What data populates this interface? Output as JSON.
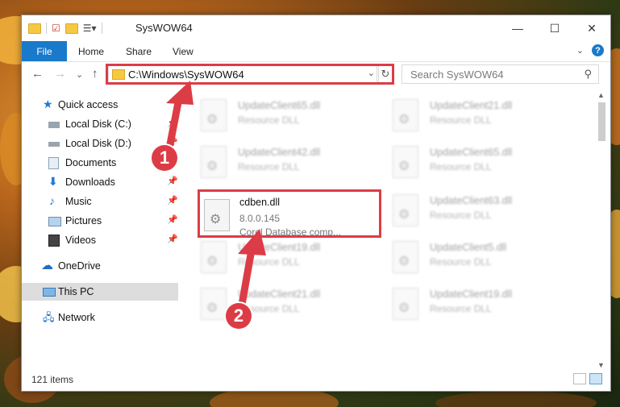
{
  "window": {
    "title": "SysWOW64",
    "minimize": "—",
    "maximize": "☐",
    "close": "✕"
  },
  "ribbon": {
    "file_tab": "File",
    "tabs": [
      "Home",
      "Share",
      "View"
    ],
    "expand": "⌄",
    "help": "?"
  },
  "navigation": {
    "back": "←",
    "forward": "→",
    "recent": "⌄",
    "up": "↑",
    "address": "C:\\Windows\\SysWOW64",
    "address_dropdown": "⌄",
    "refresh": "↻",
    "search_placeholder": "Search SysWOW64",
    "search_icon": "⚲"
  },
  "sidebar": {
    "items": [
      {
        "label": "Quick access",
        "icon": "star-icon",
        "pinned": false
      },
      {
        "label": "Local Disk (C:)",
        "icon": "drive-icon",
        "pinned": true
      },
      {
        "label": "Local Disk (D:)",
        "icon": "drive-icon",
        "pinned": true
      },
      {
        "label": "Documents",
        "icon": "documents-icon",
        "pinned": true
      },
      {
        "label": "Downloads",
        "icon": "download-icon",
        "pinned": true
      },
      {
        "label": "Music",
        "icon": "music-icon",
        "pinned": true
      },
      {
        "label": "Pictures",
        "icon": "pictures-icon",
        "pinned": true
      },
      {
        "label": "Videos",
        "icon": "videos-icon",
        "pinned": true
      },
      {
        "label": "OneDrive",
        "icon": "cloud-icon",
        "pinned": false
      },
      {
        "label": "This PC",
        "icon": "computer-icon",
        "pinned": false,
        "selected": true
      },
      {
        "label": "Network",
        "icon": "network-icon",
        "pinned": false
      }
    ],
    "pin_glyph": "📌"
  },
  "files": [
    {
      "name": "UpdateClient65.dll",
      "line2": "Resource DLL",
      "line3": "",
      "highlighted": false
    },
    {
      "name": "UpdateClient21.dll",
      "line2": "Resource DLL",
      "line3": "",
      "highlighted": false
    },
    {
      "name": "UpdateClient42.dll",
      "line2": "Resource DLL",
      "line3": "",
      "highlighted": false
    },
    {
      "name": "UpdateClient65.dll",
      "line2": "Resource DLL",
      "line3": "",
      "highlighted": false
    },
    {
      "name": "cdben.dll",
      "line2": "8.0.0.145",
      "line3": "Corel Database comp...",
      "highlighted": true
    },
    {
      "name": "UpdateClient63.dll",
      "line2": "Resource DLL",
      "line3": "",
      "highlighted": false
    },
    {
      "name": "UpdateClient19.dll",
      "line2": "Resource DLL",
      "line3": "",
      "highlighted": false
    },
    {
      "name": "UpdateClient5.dll",
      "line2": "Resource DLL",
      "line3": "",
      "highlighted": false
    },
    {
      "name": "UpdateClient21.dll",
      "line2": "Resource DLL",
      "line3": "",
      "highlighted": false
    },
    {
      "name": "UpdateClient19.dll",
      "line2": "Resource DLL",
      "line3": "",
      "highlighted": false
    }
  ],
  "status": {
    "item_count": "121 items"
  },
  "annotations": {
    "callout_1": "1",
    "callout_2": "2",
    "color": "#dc3c46"
  }
}
